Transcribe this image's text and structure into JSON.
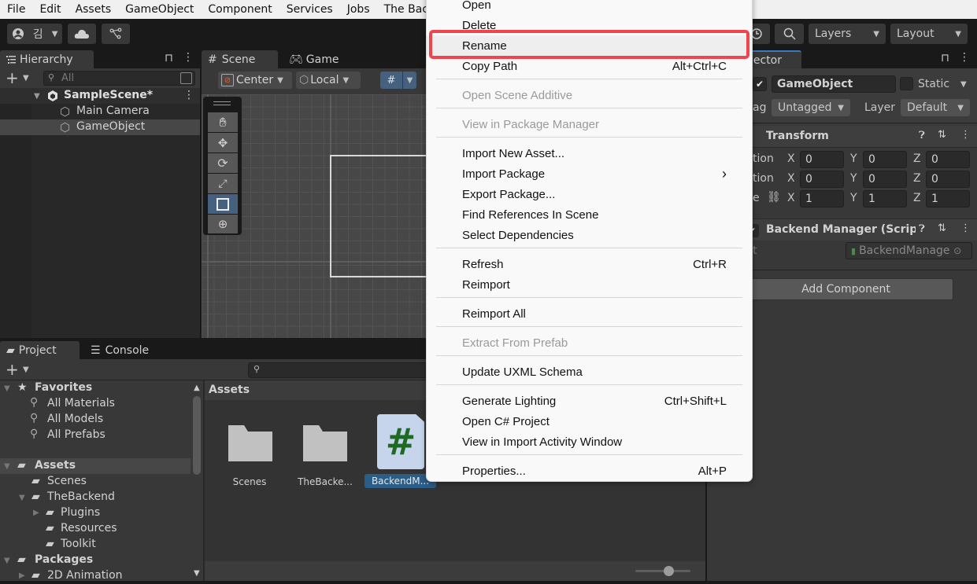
{
  "menubar": [
    "File",
    "Edit",
    "Assets",
    "GameObject",
    "Component",
    "Services",
    "Jobs",
    "The Backe"
  ],
  "toolbar": {
    "account_label": "김",
    "layers_label": "Layers",
    "layout_label": "Layout"
  },
  "hierarchy": {
    "tab_label": "Hierarchy",
    "search_placeholder": "All",
    "scene_name": "SampleScene*",
    "items": [
      "Main Camera",
      "GameObject"
    ]
  },
  "scene_view": {
    "tabs": [
      "Scene",
      "Game"
    ],
    "pivot_label": "Center",
    "space_label": "Local"
  },
  "project": {
    "tabs": [
      "Project",
      "Console"
    ],
    "favorites_label": "Favorites",
    "favorites": [
      "All Materials",
      "All Models",
      "All Prefabs"
    ],
    "assets_label": "Assets",
    "assets_tree": [
      "Scenes",
      "TheBackend",
      "Plugins",
      "Resources",
      "Toolkit"
    ],
    "packages_label": "Packages",
    "packages_tree": [
      "2D Animation"
    ],
    "breadcrumb": "Assets",
    "grid_items": [
      "Scenes",
      "TheBacke...",
      "BackendM..."
    ],
    "zoom_slider_fraction": 0.6
  },
  "inspector": {
    "tab_label": "pector",
    "object_name": "GameObject",
    "static_label": "Static",
    "tag_label": "ag",
    "tag_value": "Untagged",
    "layer_label": "Layer",
    "layer_value": "Default",
    "transform": {
      "title": "Transform",
      "rows": [
        {
          "label": "tion",
          "x": "0",
          "y": "0",
          "z": "0"
        },
        {
          "label": "tion",
          "x": "0",
          "y": "0",
          "z": "0"
        },
        {
          "label": "e",
          "x": "1",
          "y": "1",
          "z": "1"
        }
      ]
    },
    "script_component": {
      "title": "Backend Manager (Script",
      "field_label": "t",
      "field_value": "BackendManage"
    },
    "add_component_label": "Add Component"
  },
  "context_menu": {
    "items": [
      {
        "label": "Open",
        "shortcut": "",
        "disabled": false
      },
      {
        "label": "Delete",
        "shortcut": "",
        "disabled": false
      },
      {
        "label": "Rename",
        "shortcut": "",
        "disabled": false,
        "highlighted": true
      },
      {
        "label": "Copy Path",
        "shortcut": "Alt+Ctrl+C",
        "disabled": false
      },
      {
        "label": "Open Scene Additive",
        "shortcut": "",
        "disabled": true
      },
      {
        "label": "View in Package Manager",
        "shortcut": "",
        "disabled": true
      },
      {
        "label": "Import New Asset...",
        "shortcut": "",
        "disabled": false
      },
      {
        "label": "Import Package",
        "shortcut": "›",
        "disabled": false
      },
      {
        "label": "Export Package...",
        "shortcut": "",
        "disabled": false
      },
      {
        "label": "Find References In Scene",
        "shortcut": "",
        "disabled": false
      },
      {
        "label": "Select Dependencies",
        "shortcut": "",
        "disabled": false
      },
      {
        "label": "Refresh",
        "shortcut": "Ctrl+R",
        "disabled": false
      },
      {
        "label": "Reimport",
        "shortcut": "",
        "disabled": false
      },
      {
        "label": "Reimport All",
        "shortcut": "",
        "disabled": false
      },
      {
        "label": "Extract From Prefab",
        "shortcut": "",
        "disabled": true
      },
      {
        "label": "Update UXML Schema",
        "shortcut": "",
        "disabled": false
      },
      {
        "label": "Generate Lighting",
        "shortcut": "Ctrl+Shift+L",
        "disabled": false
      },
      {
        "label": "Open C# Project",
        "shortcut": "",
        "disabled": false
      },
      {
        "label": "View in Import Activity Window",
        "shortcut": "",
        "disabled": false
      },
      {
        "label": "Properties...",
        "shortcut": "Alt+P",
        "disabled": false
      }
    ]
  },
  "colors": {
    "highlight_box": "#f0454f",
    "selection_blue": "#2c5d87",
    "script_icon_hash": "#1d6a23"
  }
}
